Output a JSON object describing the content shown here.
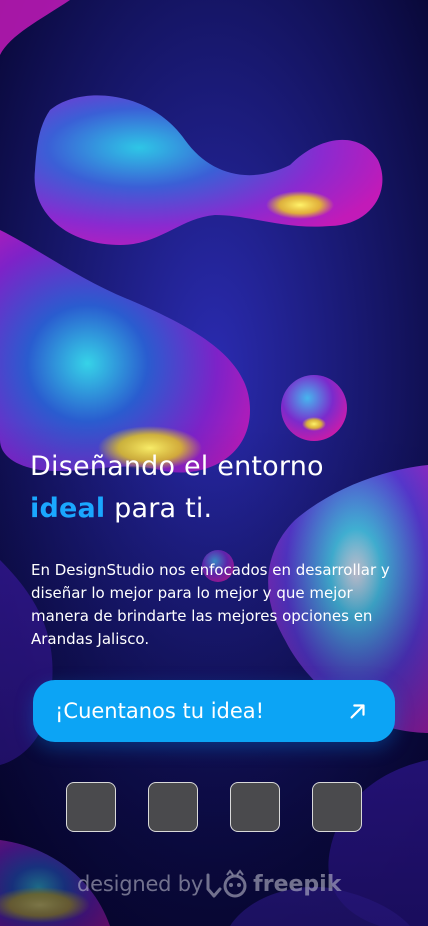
{
  "hero": {
    "headline_line1": "Diseñando el entorno",
    "headline_accent": "ideal",
    "headline_rest": " para ti.",
    "description": "En DesignStudio nos enfocados en desarrollar y diseñar lo mejor para lo mejor y que mejor manera de brindarte las mejores opciones en Arandas Jalisco."
  },
  "cta": {
    "label": "¡Cuentanos tu idea!",
    "icon": "arrow-up-right-icon"
  },
  "tiles": [
    {
      "name": "tile-1"
    },
    {
      "name": "tile-2"
    },
    {
      "name": "tile-3"
    },
    {
      "name": "tile-4"
    }
  ],
  "watermark": {
    "prefix": "designed by",
    "brand": "freepik",
    "icon": "freepik-logo-icon"
  },
  "colors": {
    "accent": "#1aa7ff",
    "cta_background": "#0ca4f5",
    "tile_fill": "#4a4a4d",
    "background": "#0a0b55"
  }
}
